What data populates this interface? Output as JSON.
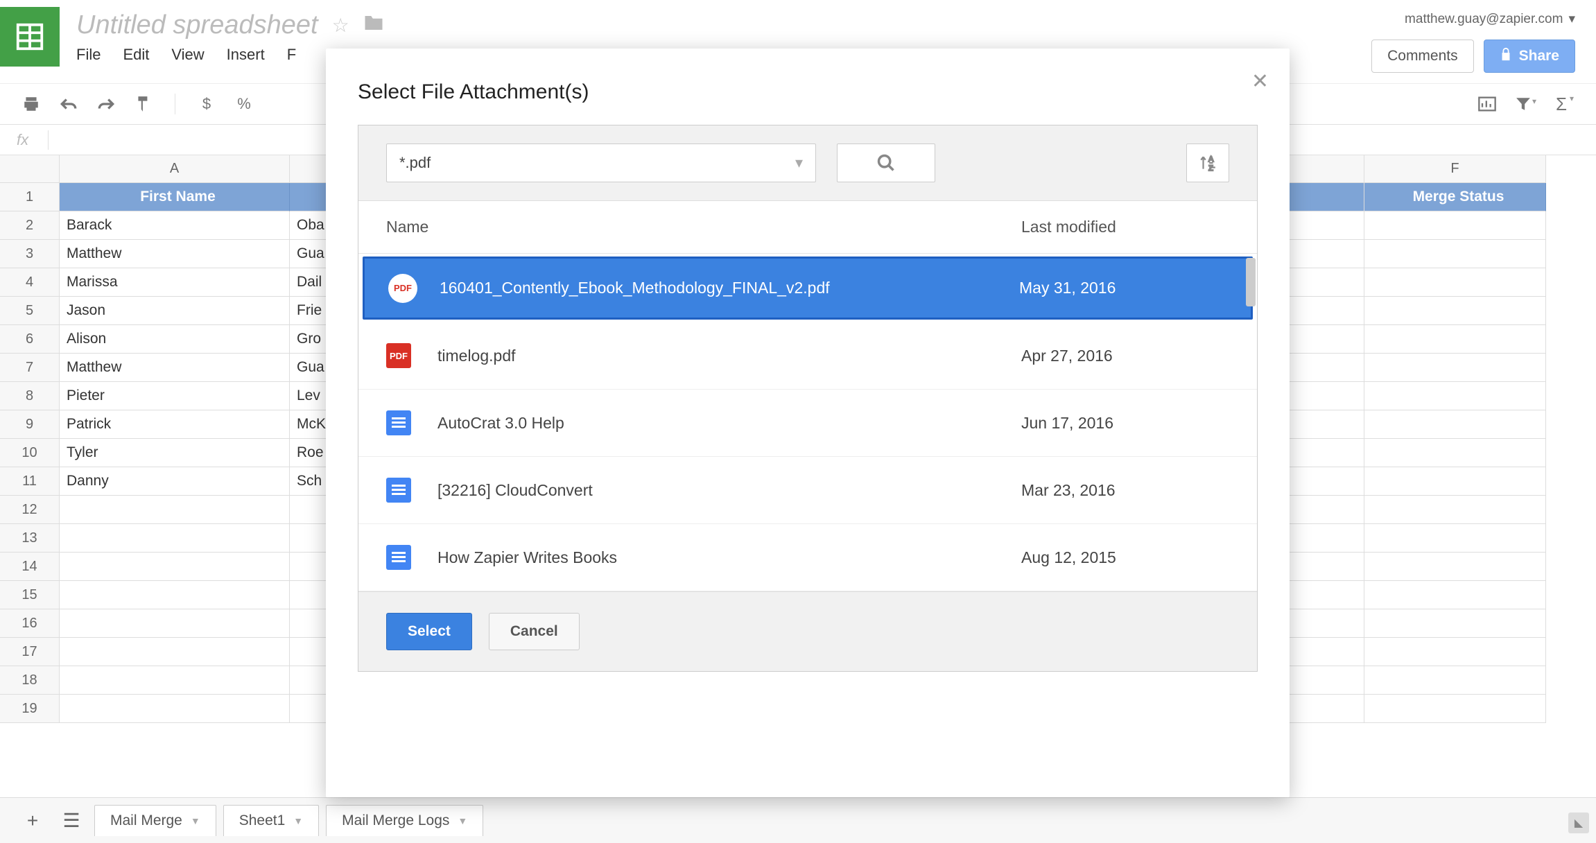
{
  "header": {
    "doc_title": "Untitled spreadsheet",
    "user_email": "matthew.guay@zapier.com",
    "comments_label": "Comments",
    "share_label": "Share"
  },
  "menu": {
    "file": "File",
    "edit": "Edit",
    "view": "View",
    "insert": "Insert",
    "format": "F"
  },
  "toolbar": {
    "dollar": "$",
    "percent": "%"
  },
  "fx_label": "fx",
  "columns": [
    "A",
    "F"
  ],
  "header_row": {
    "col_a": "First Name",
    "col_f": "Merge Status"
  },
  "rows": [
    {
      "n": "1"
    },
    {
      "n": "2",
      "a": "Barack",
      "b": "Oba"
    },
    {
      "n": "3",
      "a": "Matthew",
      "b": "Gua"
    },
    {
      "n": "4",
      "a": "Marissa",
      "b": "Dail"
    },
    {
      "n": "5",
      "a": "Jason",
      "b": "Frie"
    },
    {
      "n": "6",
      "a": "Alison",
      "b": "Gro"
    },
    {
      "n": "7",
      "a": "Matthew",
      "b": "Gua"
    },
    {
      "n": "8",
      "a": "Pieter",
      "b": "Lev"
    },
    {
      "n": "9",
      "a": "Patrick",
      "b": "McK"
    },
    {
      "n": "10",
      "a": "Tyler",
      "b": "Roe"
    },
    {
      "n": "11",
      "a": "Danny",
      "b": "Sch"
    },
    {
      "n": "12"
    },
    {
      "n": "13"
    },
    {
      "n": "14"
    },
    {
      "n": "15"
    },
    {
      "n": "16"
    },
    {
      "n": "17"
    },
    {
      "n": "18"
    },
    {
      "n": "19"
    }
  ],
  "tabs": {
    "t1": "Mail Merge",
    "t2": "Sheet1",
    "t3": "Mail Merge Logs"
  },
  "modal": {
    "title": "Select File Attachment(s)",
    "filter": "*.pdf",
    "col_name": "Name",
    "col_date": "Last modified",
    "files": [
      {
        "icon": "pdf",
        "name": "160401_Contently_Ebook_Methodology_FINAL_v2.pdf",
        "date": "May 31, 2016",
        "selected": true
      },
      {
        "icon": "pdf",
        "name": "timelog.pdf",
        "date": "Apr 27, 2016"
      },
      {
        "icon": "doc",
        "name": "AutoCrat 3.0 Help",
        "date": "Jun 17, 2016"
      },
      {
        "icon": "doc",
        "name": "[32216] CloudConvert",
        "date": "Mar 23, 2016"
      },
      {
        "icon": "doc",
        "name": "How Zapier Writes Books",
        "date": "Aug 12, 2015"
      }
    ],
    "select_label": "Select",
    "cancel_label": "Cancel"
  }
}
